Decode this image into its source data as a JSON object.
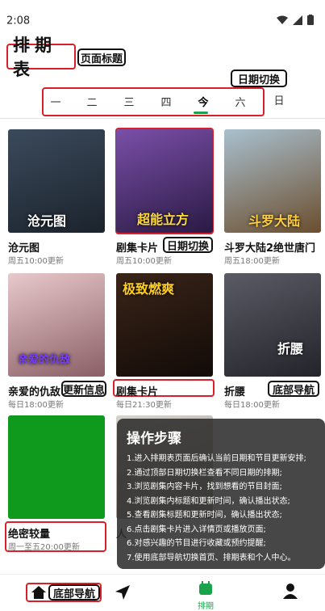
{
  "status": {
    "time": "2:08"
  },
  "header": {
    "title": "排期表"
  },
  "annotations": {
    "page_title": "页面标题",
    "date_switch": "日期切换",
    "card_date_switch": "日期切换",
    "update_info": "更新信息",
    "bottom_nav_right": "底部导航",
    "bottom_nav_left": "底部导航"
  },
  "date_tabs": [
    "一",
    "二",
    "三",
    "四",
    "今",
    "六",
    "日"
  ],
  "cards": [
    {
      "title": "沧元图",
      "sub": "周五10:00更新",
      "logo": "沧元图",
      "bg": "#27313c"
    },
    {
      "title": "剧集卡片",
      "sub": "周五10:00更新",
      "logo": "超能立方",
      "bg": "#4a2f6b"
    },
    {
      "title": "斗罗大陆2绝世唐门",
      "sub": "周五18:00更新",
      "logo": "斗罗大陆",
      "bg": "#7e6a52"
    },
    {
      "title": "亲爱的仇敌",
      "sub": "每日18:00更新",
      "logo": "亲爱的仇敌",
      "bg": "#b37f86"
    },
    {
      "title": "剧集卡片",
      "sub": "每日21:30更新",
      "logo": "极致燃爽",
      "bg": "#2a1b17"
    },
    {
      "title": "折腰",
      "sub": "每日18:00更新",
      "logo": "折腰",
      "bg": "#3d3d44"
    },
    {
      "title": "绝密较量",
      "sub": "周一至五20:00更新",
      "logo": "",
      "bg": "#0f9a1d"
    },
    {
      "title": "人",
      "sub": "",
      "logo": "",
      "bg": "#cfc9c2"
    }
  ],
  "overlay": {
    "title": "操作步骤",
    "steps": [
      "1.进入排期表页面后确认当前日期和节目更新安排;",
      "2.通过顶部日期切换栏查看不同日期的排期;",
      "3.浏览剧集内容卡片，找到想看的节目封面;",
      "4.浏览剧集内标题和更新时间，确认播出状态;",
      "5.查看剧集标题和更新时间，确认播出状态;",
      "6.点击剧集卡片进入详情页或播放页面;",
      "6.对感兴趣的节目进行收藏或预约提醒;",
      "7.使用底部导航切换首页、排期表和个人中心。"
    ]
  },
  "bottom_nav": {
    "active_label": "排期"
  },
  "colors": {
    "accent": "#1aa34a",
    "annotation_red": "#d9202a"
  }
}
